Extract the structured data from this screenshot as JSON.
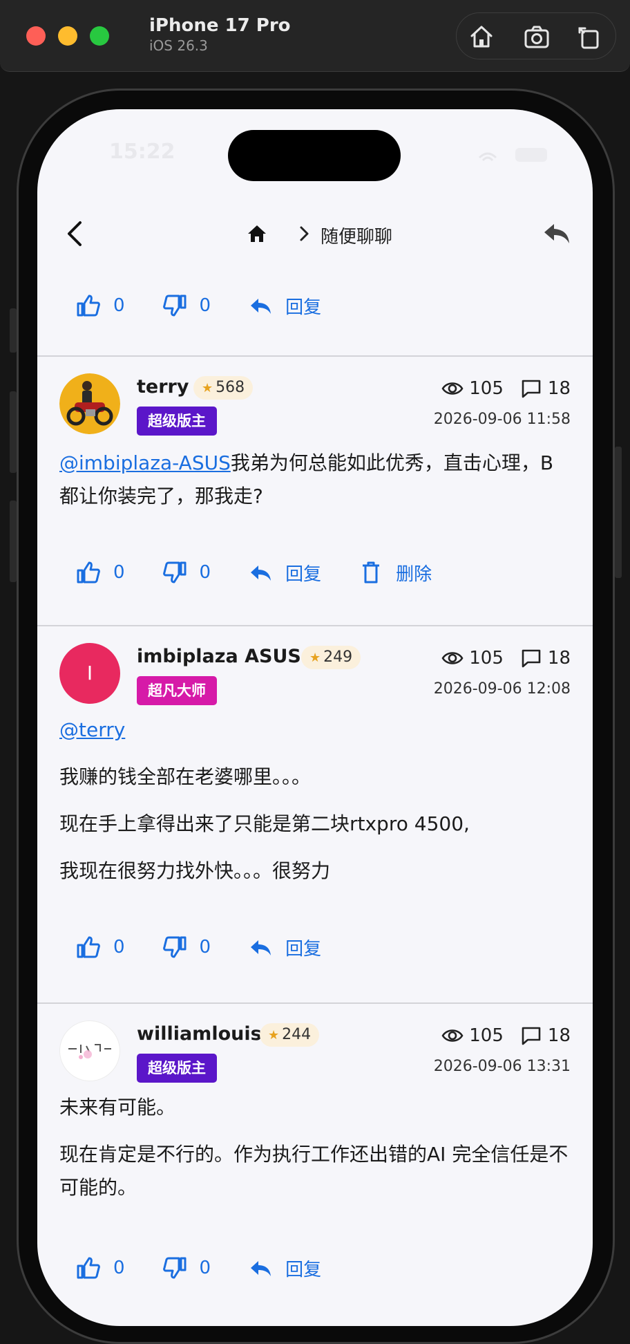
{
  "simulator": {
    "device": "iPhone 17 Pro",
    "os": "iOS 26.3",
    "buttons": [
      "home-icon",
      "screenshot-icon",
      "rotate-icon"
    ]
  },
  "status": {
    "time": "15:22"
  },
  "nav": {
    "crumb": "随便聊聊"
  },
  "top_actions": {
    "likes": "0",
    "dislikes": "0",
    "reply": "回复"
  },
  "posts": [
    {
      "author": "terry",
      "points": "568",
      "role": "超级版主",
      "role_color": "#5b16c9",
      "views": "105",
      "comments": "18",
      "time": "2026-09-06 11:58",
      "mention": "@imbiplaza-ASUS",
      "text": "我弟为何总能如此优秀，直击心理，B都让你装完了，那我走?",
      "likes": "0",
      "dislikes": "0",
      "reply": "回复",
      "delete": "删除"
    },
    {
      "author": "imbiplaza ASUS",
      "points": "249",
      "role": "超凡大师",
      "role_color": "#d61aa8",
      "avatar_letter": "I",
      "avatar_color": "#e8295f",
      "views": "105",
      "comments": "18",
      "time": "2026-09-06 12:08",
      "mention": "@terry",
      "lines": [
        "我赚的钱全部在老婆哪里。。。",
        "现在手上拿得出来了只能是第二块rtxpro 4500,",
        "我现在很努力找外快。。。很努力"
      ],
      "likes": "0",
      "dislikes": "0",
      "reply": "回复"
    },
    {
      "author": "williamlouis",
      "points": "244",
      "role": "超级版主",
      "role_color": "#5b16c9",
      "views": "105",
      "comments": "18",
      "time": "2026-09-06 13:31",
      "lines": [
        "未来有可能。",
        "现在肯定是不行的。作为执行工作还出错的AI 完全信任是不可能的。"
      ],
      "likes": "0",
      "dislikes": "0",
      "reply": "回复"
    }
  ],
  "colors": {
    "accent": "#1a6ee0",
    "screen_bg": "#f6f6fa",
    "super_mod": "#5b16c9",
    "master": "#d61aa8"
  }
}
